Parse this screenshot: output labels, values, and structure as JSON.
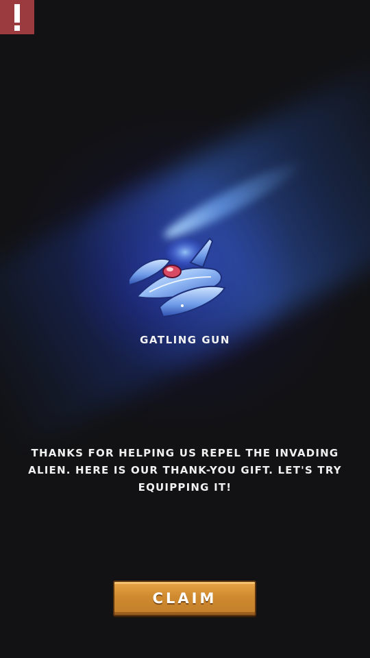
{
  "alert": {
    "icon": "exclamation-icon",
    "color": "#9b3a3f"
  },
  "reward": {
    "icon": "spaceship-icon",
    "name": "GATLING GUN"
  },
  "message": "THANKS FOR HELPING US REPEL THE INVADING ALIEN. HERE IS OUR THANK-YOU GIFT. LET'S TRY EQUIPPING IT!",
  "claim_button": {
    "label": "CLAIM",
    "color": "#cf8a2f"
  }
}
